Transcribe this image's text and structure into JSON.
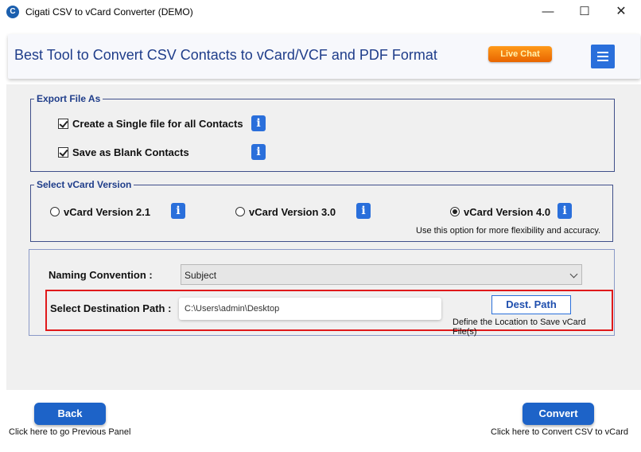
{
  "window": {
    "title": "Cigati CSV to vCard Converter (DEMO)",
    "logo_glyph": "C",
    "minimize_glyph": "—",
    "maximize_glyph": "☐",
    "close_glyph": "✕"
  },
  "header": {
    "title": "Best Tool to Convert CSV Contacts to vCard/VCF and PDF Format",
    "live_chat_label": "Live Chat"
  },
  "export_group": {
    "legend": "Export File As",
    "options": [
      {
        "label": "Create a Single file for all Contacts",
        "checked": true
      },
      {
        "label": "Save as Blank Contacts",
        "checked": true
      }
    ]
  },
  "version_group": {
    "legend": "Select vCard Version",
    "options": [
      {
        "label": "vCard Version 2.1",
        "selected": false
      },
      {
        "label": "vCard Version 3.0",
        "selected": false
      },
      {
        "label": "vCard Version 4.0",
        "selected": true
      }
    ],
    "hint": "Use this option for more flexibility and accuracy."
  },
  "options_group": {
    "naming_label": "Naming Convention :",
    "naming_value": "Subject",
    "dest_label": "Select Destination Path :",
    "dest_value": "C:\\Users\\admin\\Desktop",
    "dest_button": "Dest. Path",
    "dest_hint": "Define the Location to Save vCard File(s)"
  },
  "footer": {
    "back_label": "Back",
    "back_hint": "Click here to go Previous Panel",
    "convert_label": "Convert",
    "convert_hint": "Click here to Convert CSV to vCard"
  },
  "info_glyph": "i",
  "colors": {
    "accent": "#2a6fdb",
    "title_blue": "#1f3d8a",
    "highlight_red": "#e0191b",
    "live_chat_orange": "#f07a0a"
  }
}
